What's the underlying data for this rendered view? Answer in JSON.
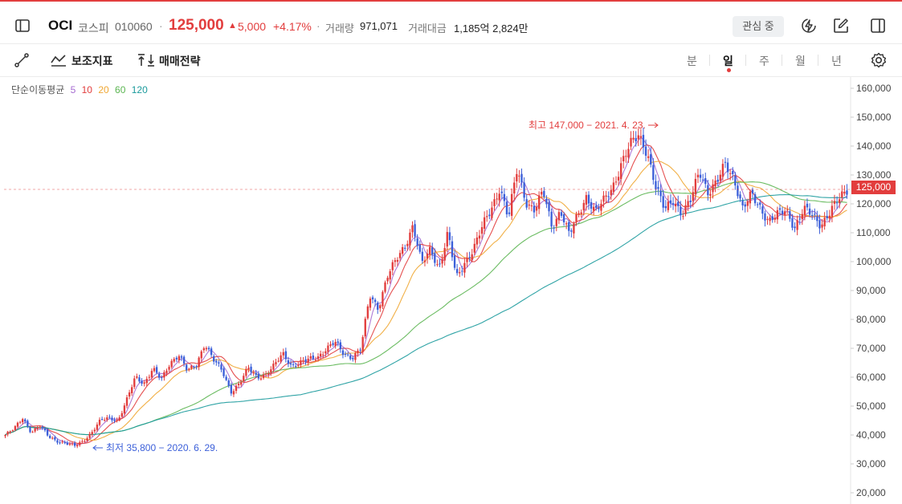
{
  "header": {
    "ticker": "OCI",
    "market": "코스피",
    "code": "010060",
    "separator": "·",
    "price": "125,000",
    "change_arrow": "▲",
    "change": "5,000",
    "change_pct": "+4.17%",
    "volume_label": "거래량",
    "volume": "971,071",
    "amount_label": "거래대금",
    "amount": "1,185억 2,824만",
    "watch_button": "관심 중",
    "icons": [
      "sidebar-toggle-icon",
      "lightning-icon",
      "edit-icon",
      "layout-icon"
    ]
  },
  "toolbar": {
    "draw_tool_icon": "line-draw-icon",
    "indicator_label": "보조지표",
    "strategy_label": "매매전략",
    "periods": [
      "분",
      "일",
      "주",
      "월",
      "년"
    ],
    "active_period": "일",
    "settings_icon": "gear-icon"
  },
  "moving_average": {
    "label": "단순이동평균",
    "periods": [
      "5",
      "10",
      "20",
      "60",
      "120"
    ],
    "colors": [
      "#a66bd1",
      "#e23d3d",
      "#f0a733",
      "#5bb551",
      "#1a9a9c"
    ]
  },
  "chart_data": {
    "type": "candlestick",
    "y_axis_ticks": [
      "160,000",
      "150,000",
      "140,000",
      "130,000",
      "120,000",
      "110,000",
      "100,000",
      "90,000",
      "80,000",
      "70,000",
      "60,000",
      "50,000",
      "40,000",
      "30,000",
      "20,000"
    ],
    "ylim": [
      20000,
      160000
    ],
    "current_price_label": "125,000",
    "annotations": {
      "high": "최고 147,000 − 2021. 4. 23.",
      "low": "최저 35,800 − 2020. 6. 29."
    },
    "colors": {
      "up": "#e23d3d",
      "down": "#3b5fd9"
    },
    "close_path": [
      40000,
      42000,
      46000,
      41000,
      43000,
      39500,
      38000,
      37000,
      36200,
      38000,
      41000,
      45000,
      46000,
      45000,
      52000,
      60000,
      58000,
      63000,
      59000,
      65000,
      68000,
      62000,
      64000,
      72000,
      66000,
      62000,
      55000,
      58000,
      63000,
      60000,
      61000,
      64000,
      68000,
      64000,
      65000,
      66000,
      67000,
      70000,
      72000,
      68000,
      67000,
      70000,
      88000,
      84000,
      95000,
      100000,
      105000,
      113000,
      99000,
      104000,
      98000,
      110000,
      94000,
      100000,
      105000,
      112000,
      118000,
      126000,
      115000,
      132000,
      121000,
      118000,
      124000,
      112000,
      118000,
      109000,
      116000,
      123000,
      117000,
      121000,
      126000,
      134000,
      140000,
      144000,
      138000,
      125000,
      118000,
      122000,
      116000,
      121000,
      132000,
      124000,
      127000,
      134000,
      129000,
      118000,
      123000,
      119000,
      114000,
      116000,
      118000,
      112000,
      118000,
      116000,
      113000,
      117000,
      121000,
      125000
    ],
    "ma_lines": [
      "5",
      "10",
      "20",
      "60",
      "120"
    ]
  }
}
